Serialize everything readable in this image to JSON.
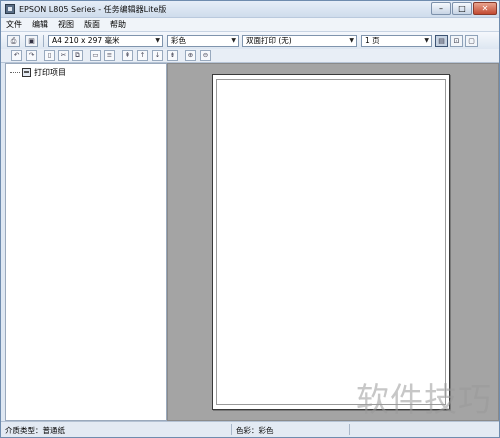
{
  "window": {
    "title": "EPSON L805 Series - 任务编辑器Lite版",
    "controls": {
      "minimize": "–",
      "maximize": "□",
      "close": "✕"
    }
  },
  "menu": [
    "文件",
    "编辑",
    "视图",
    "版面",
    "帮助"
  ],
  "toolbar": {
    "paper_size": "A4 210 x 297 毫米",
    "color_mode": "彩色",
    "duplex": "双面打印 (无)",
    "pages_per_sheet": "1 页"
  },
  "tree": {
    "root_label": "打印项目"
  },
  "status": {
    "media_type": "介质类型：普通纸",
    "color": "色彩：彩色"
  },
  "watermark": "软件技巧"
}
